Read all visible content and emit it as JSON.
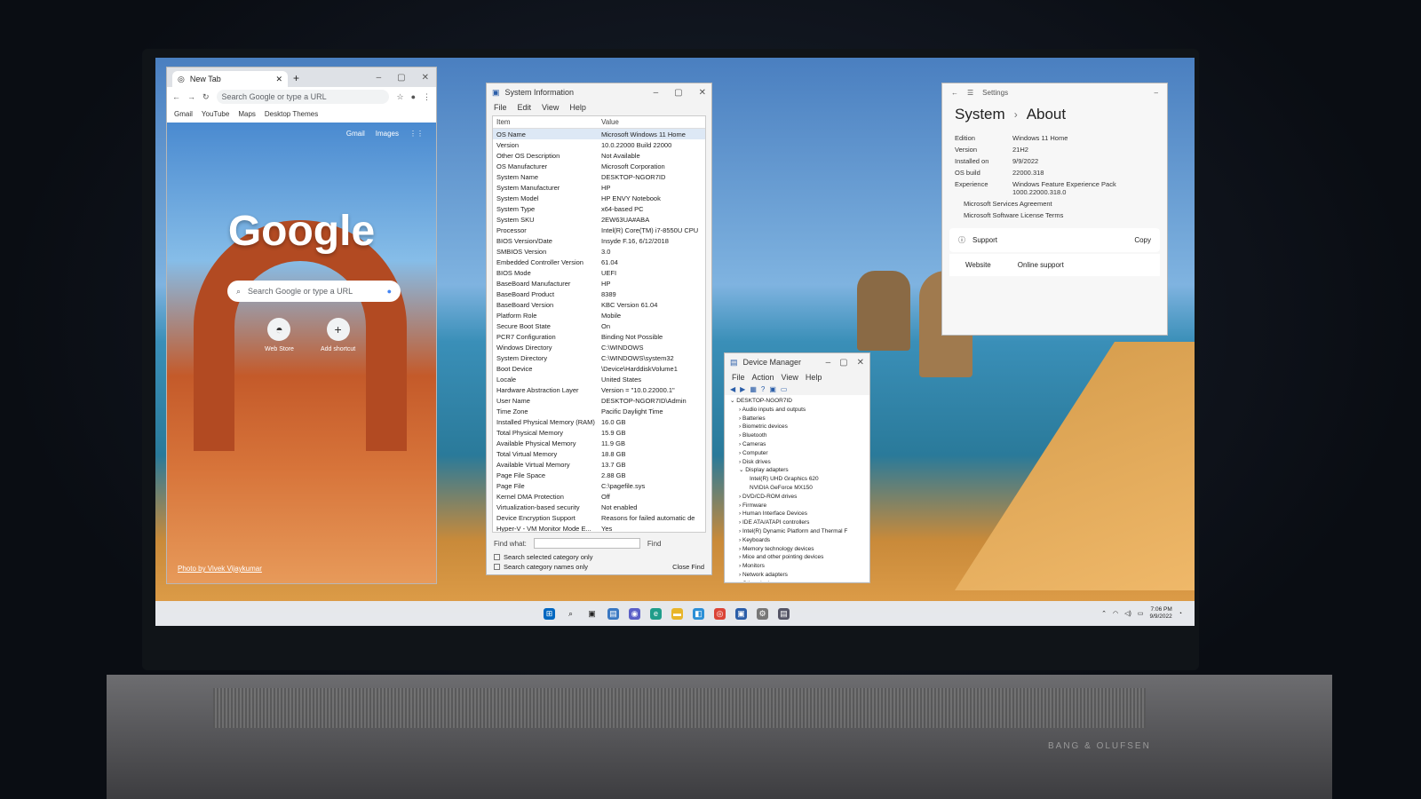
{
  "chrome": {
    "tab_title": "New Tab",
    "new_tab": "+",
    "omnibox_placeholder": "Search Google or type a URL",
    "bookmarks": [
      "Gmail",
      "YouTube",
      "Maps",
      "Desktop Themes"
    ],
    "ntp": {
      "top_links": [
        "Gmail",
        "Images"
      ],
      "logo": "Google",
      "search_placeholder": "Search Google or type a URL",
      "shortcuts": [
        "Web Store",
        "Add shortcut"
      ],
      "photo_credit": "Photo by Vivek Vijaykumar"
    }
  },
  "sysinfo": {
    "title": "System Information",
    "menu": [
      "File",
      "Edit",
      "View",
      "Help"
    ],
    "columns": [
      "Item",
      "Value"
    ],
    "rows": [
      [
        "OS Name",
        "Microsoft Windows 11 Home"
      ],
      [
        "Version",
        "10.0.22000 Build 22000"
      ],
      [
        "Other OS Description",
        "Not Available"
      ],
      [
        "OS Manufacturer",
        "Microsoft Corporation"
      ],
      [
        "System Name",
        "DESKTOP-NGOR7ID"
      ],
      [
        "System Manufacturer",
        "HP"
      ],
      [
        "System Model",
        "HP ENVY Notebook"
      ],
      [
        "System Type",
        "x64-based PC"
      ],
      [
        "System SKU",
        "2EW63UA#ABA"
      ],
      [
        "Processor",
        "Intel(R) Core(TM) i7-8550U CPU"
      ],
      [
        "BIOS Version/Date",
        "Insyde F.16, 6/12/2018"
      ],
      [
        "SMBIOS Version",
        "3.0"
      ],
      [
        "Embedded Controller Version",
        "61.04"
      ],
      [
        "BIOS Mode",
        "UEFI"
      ],
      [
        "BaseBoard Manufacturer",
        "HP"
      ],
      [
        "BaseBoard Product",
        "8389"
      ],
      [
        "BaseBoard Version",
        "KBC Version 61.04"
      ],
      [
        "Platform Role",
        "Mobile"
      ],
      [
        "Secure Boot State",
        "On"
      ],
      [
        "PCR7 Configuration",
        "Binding Not Possible"
      ],
      [
        "Windows Directory",
        "C:\\WINDOWS"
      ],
      [
        "System Directory",
        "C:\\WINDOWS\\system32"
      ],
      [
        "Boot Device",
        "\\Device\\HarddiskVolume1"
      ],
      [
        "Locale",
        "United States"
      ],
      [
        "Hardware Abstraction Layer",
        "Version = \"10.0.22000.1\""
      ],
      [
        "User Name",
        "DESKTOP-NGOR7ID\\Admin"
      ],
      [
        "Time Zone",
        "Pacific Daylight Time"
      ],
      [
        "Installed Physical Memory (RAM)",
        "16.0 GB"
      ],
      [
        "Total Physical Memory",
        "15.9 GB"
      ],
      [
        "Available Physical Memory",
        "11.9 GB"
      ],
      [
        "Total Virtual Memory",
        "18.8 GB"
      ],
      [
        "Available Virtual Memory",
        "13.7 GB"
      ],
      [
        "Page File Space",
        "2.88 GB"
      ],
      [
        "Page File",
        "C:\\pagefile.sys"
      ],
      [
        "Kernel DMA Protection",
        "Off"
      ],
      [
        "Virtualization-based security",
        "Not enabled"
      ],
      [
        "Device Encryption Support",
        "Reasons for failed automatic de"
      ],
      [
        "Hyper-V - VM Monitor Mode E...",
        "Yes"
      ]
    ],
    "find_label": "Find what:",
    "find_button": "Find",
    "close_find": "Close Find",
    "check1": "Search selected category only",
    "check2": "Search category names only"
  },
  "devmgr": {
    "title": "Device Manager",
    "menu": [
      "File",
      "Action",
      "View",
      "Help"
    ],
    "root": "DESKTOP-NGOR7ID",
    "categories": [
      "Audio inputs and outputs",
      "Batteries",
      "Biometric devices",
      "Bluetooth",
      "Cameras",
      "Computer",
      "Disk drives",
      "Display adapters"
    ],
    "display_children": [
      "Intel(R) UHD Graphics 620",
      "NVIDIA GeForce MX150"
    ],
    "categories_after": [
      "DVD/CD-ROM drives",
      "Firmware",
      "Human Interface Devices",
      "IDE ATA/ATAPI controllers",
      "Intel(R) Dynamic Platform and Thermal F",
      "Keyboards",
      "Memory technology devices",
      "Mice and other pointing devices",
      "Monitors",
      "Network adapters",
      "Other devices"
    ]
  },
  "settings": {
    "app_title": "Settings",
    "breadcrumb_parent": "System",
    "breadcrumb_sep": "›",
    "breadcrumb_current": "About",
    "specs": [
      [
        "Edition",
        "Windows 11 Home"
      ],
      [
        "Version",
        "21H2"
      ],
      [
        "Installed on",
        "9/9/2022"
      ],
      [
        "OS build",
        "22000.318"
      ],
      [
        "Experience",
        "Windows Feature Experience Pack 1000.22000.318.0"
      ]
    ],
    "links": [
      "Microsoft Services Agreement",
      "Microsoft Software License Terms"
    ],
    "support_label": "Support",
    "copy_label": "Copy",
    "website_label": "Website",
    "online_support": "Online support"
  },
  "taskbar": {
    "time": "7:06 PM",
    "date": "9/9/2022"
  },
  "colors": {
    "win_blue": "#0067c0",
    "taskbar_bg": "#e6ecf4",
    "selection": "#dde8f5"
  }
}
